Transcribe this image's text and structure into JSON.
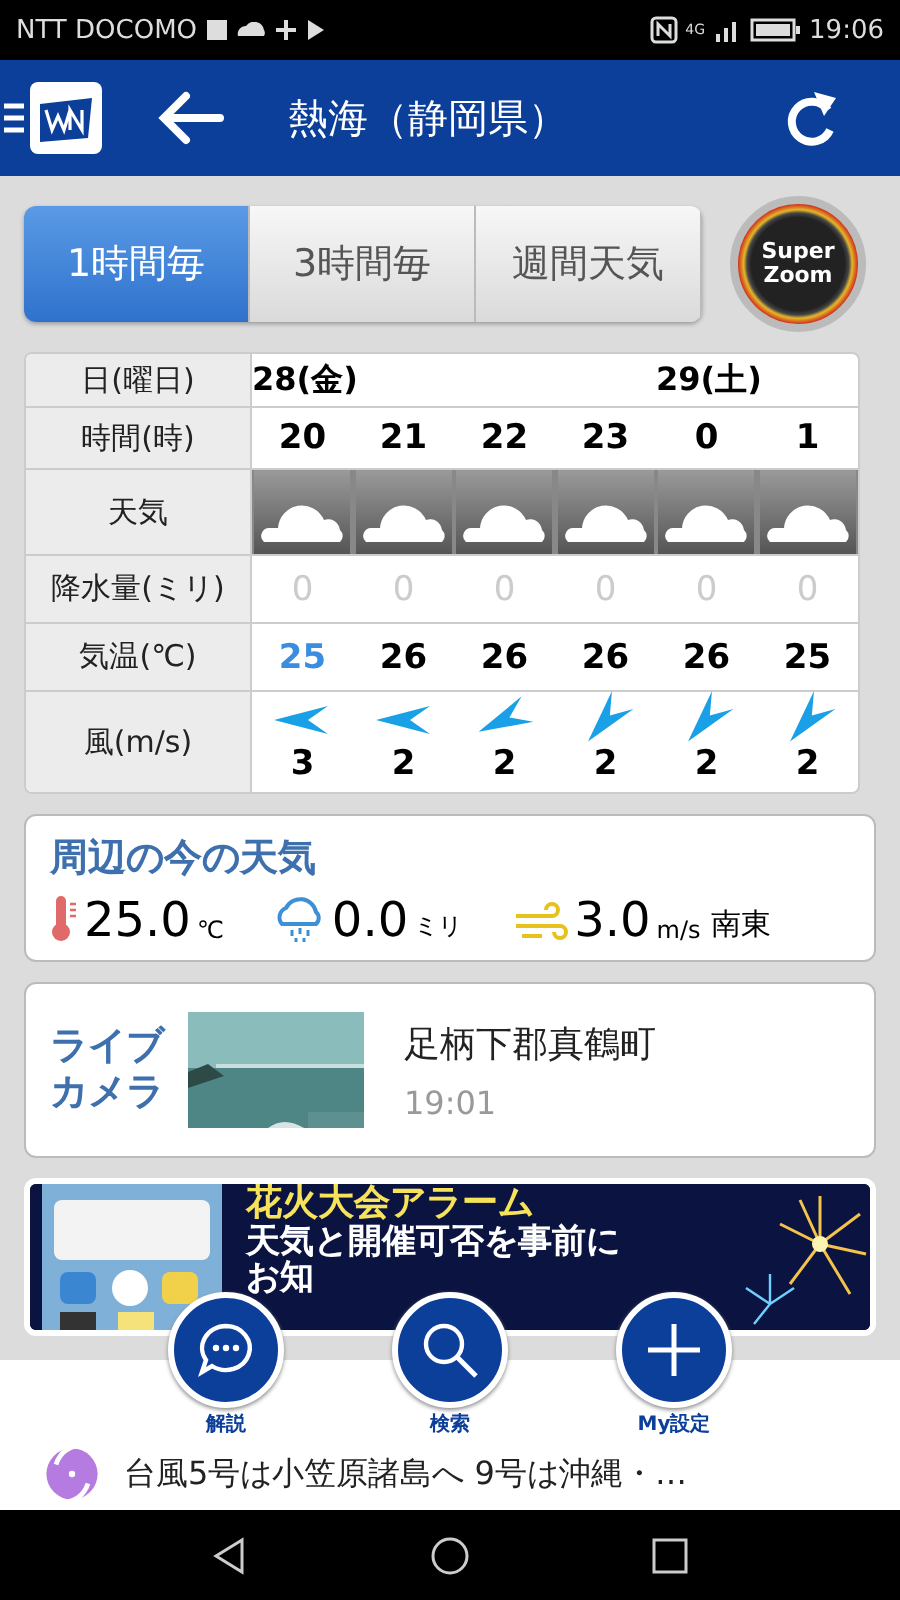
{
  "status_bar": {
    "carrier": "NTT DOCOMO",
    "network": "4G",
    "time": "19:06"
  },
  "header": {
    "title": "熱海（静岡県）"
  },
  "tabs": [
    {
      "label": "1時間毎",
      "selected": true
    },
    {
      "label": "3時間毎",
      "selected": false
    },
    {
      "label": "週間天気",
      "selected": false
    }
  ],
  "super_zoom": {
    "line_1": "Super",
    "line_2": "Zoom"
  },
  "table": {
    "row_labels": [
      "日(曜日)",
      "時間(時)",
      "天気",
      "降水量(ミリ)",
      "気温(℃)",
      "風(m/s)"
    ],
    "columns": [
      {
        "day": "28(金)",
        "hour": "20",
        "rain": "0",
        "temp": "25",
        "current": true,
        "wind": {
          "kind": "east",
          "speed": "3"
        }
      },
      {
        "hour": "21",
        "rain": "0",
        "temp": "26",
        "current": false,
        "wind": {
          "kind": "east",
          "speed": "2"
        }
      },
      {
        "hour": "22",
        "rain": "0",
        "temp": "26",
        "current": false,
        "wind": {
          "kind": "eastnortheast",
          "speed": "2"
        }
      },
      {
        "hour": "23",
        "rain": "0",
        "temp": "26",
        "current": false,
        "wind": {
          "kind": "northeast",
          "speed": "2"
        }
      },
      {
        "day": "29(土)",
        "hour": "0",
        "rain": "0",
        "temp": "26",
        "current": false,
        "wind": {
          "kind": "northeast",
          "speed": "2"
        }
      },
      {
        "hour": "1",
        "rain": "0",
        "temp": "25",
        "current": false,
        "wind": {
          "kind": "northeast",
          "speed": "2"
        }
      }
    ]
  },
  "current": {
    "title": "周辺の今の天気",
    "temp": "25.0",
    "temp_unit": "℃",
    "rain": "0.0",
    "rain_unit": "ミリ",
    "wind": "3.0",
    "wind_unit": "m/s",
    "wind_dir": "南東"
  },
  "live_camera": {
    "title_1": "ライブ",
    "title_2": "カメラ",
    "place": "足柄下郡真鶴町",
    "time": "19:01"
  },
  "banner": {
    "headline": "花火大会アラーム",
    "line_2": "天気と開催可否を事前に",
    "line_3": "お知"
  },
  "fab": [
    {
      "kind": "chat",
      "label": "解説"
    },
    {
      "kind": "search",
      "label": "検索"
    },
    {
      "kind": "plus",
      "label": "My設定"
    }
  ],
  "ticker": {
    "text": "台風5号は小笠原諸島へ 9号は沖縄・…"
  }
}
